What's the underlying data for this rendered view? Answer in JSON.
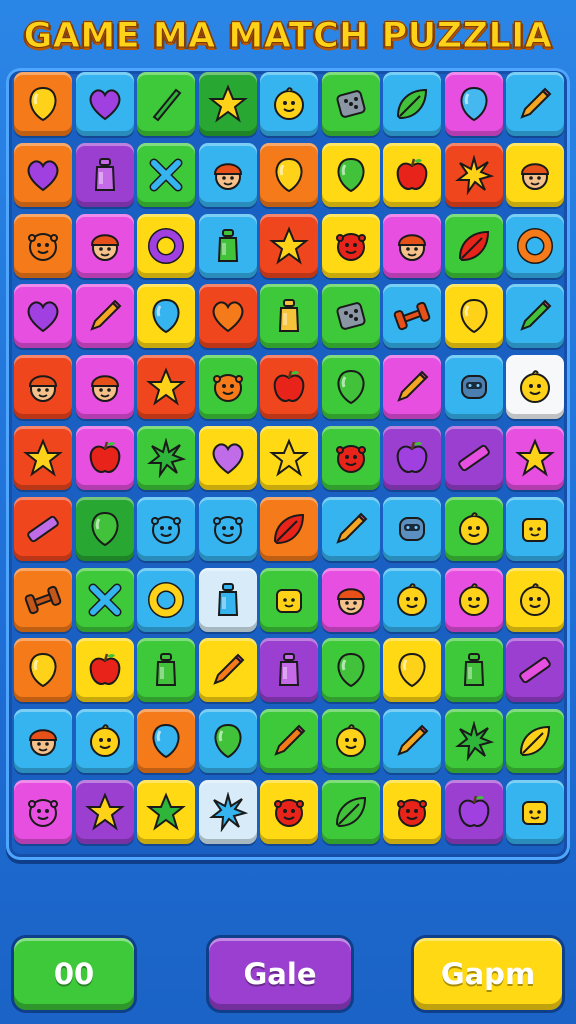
{
  "title": "GAME MA MATCH PUZZLIA",
  "colors": {
    "red": "#f0461e",
    "orange": "#f57a1a",
    "yellow": "#ffd913",
    "green": "#3ec93a",
    "dgreen": "#28a832",
    "blue": "#35b4ef",
    "purple": "#9a3fd0",
    "magenta": "#e64fe0",
    "lblue": "#d7ecf8",
    "white": "#f6f8fa"
  },
  "board": {
    "rows": [
      [
        [
          "orange",
          "balloon",
          "#ffd21a"
        ],
        [
          "blue",
          "heart",
          "#a040e0"
        ],
        [
          "green",
          "stick",
          "#2eb53a"
        ],
        [
          "dgreen",
          "star",
          "#ffd21a"
        ],
        [
          "blue",
          "face",
          "#ffd21a"
        ],
        [
          "green",
          "dice",
          "#8a96a4"
        ],
        [
          "blue",
          "leaf",
          "#42c23a"
        ],
        [
          "magenta",
          "balloon",
          "#45b8f0"
        ],
        [
          "blue",
          "pencil",
          "#f5a623"
        ]
      ],
      [
        [
          "orange",
          "heart",
          "#a040e0"
        ],
        [
          "purple",
          "bottle",
          "#c56be8"
        ],
        [
          "green",
          "cross",
          "#35b4ef"
        ],
        [
          "blue",
          "boy",
          "#f5c08a"
        ],
        [
          "orange",
          "balloon",
          "#ffd21a"
        ],
        [
          "yellow",
          "balloon",
          "#42c23a"
        ],
        [
          "yellow",
          "apple",
          "#e8231a"
        ],
        [
          "red",
          "splat",
          "#ffd21a"
        ],
        [
          "yellow",
          "boy",
          "#f5c08a"
        ]
      ],
      [
        [
          "orange",
          "monster",
          "#f57a1a"
        ],
        [
          "magenta",
          "boy",
          "#f5c08a"
        ],
        [
          "yellow",
          "ring",
          "#a040e0"
        ],
        [
          "blue",
          "bottle",
          "#42c23a"
        ],
        [
          "red",
          "star",
          "#ffd21a"
        ],
        [
          "yellow",
          "monster",
          "#e8231a"
        ],
        [
          "magenta",
          "boy",
          "#f5c08a"
        ],
        [
          "green",
          "leaf",
          "#e8231a"
        ],
        [
          "blue",
          "ring",
          "#f57a1a"
        ]
      ],
      [
        [
          "magenta",
          "heart",
          "#a040e0"
        ],
        [
          "magenta",
          "pencil",
          "#f5a623"
        ],
        [
          "yellow",
          "balloon",
          "#35b4ef"
        ],
        [
          "red",
          "heart",
          "#f57a1a"
        ],
        [
          "green",
          "bottle",
          "#f5c23a"
        ],
        [
          "green",
          "dice",
          "#8a96a4"
        ],
        [
          "blue",
          "dumbbell",
          "#e8501a"
        ],
        [
          "yellow",
          "balloon",
          "#ffd21a"
        ],
        [
          "blue",
          "pencil",
          "#42c23a"
        ]
      ],
      [
        [
          "red",
          "boy",
          "#f5c08a"
        ],
        [
          "magenta",
          "boy",
          "#f5c08a"
        ],
        [
          "red",
          "star",
          "#ffd21a"
        ],
        [
          "green",
          "monster",
          "#f57a1a"
        ],
        [
          "red",
          "apple",
          "#e8231a"
        ],
        [
          "green",
          "balloon",
          "#42c23a"
        ],
        [
          "magenta",
          "pencil",
          "#f5a623"
        ],
        [
          "blue",
          "robot",
          "#4a7fb0"
        ],
        [
          "white",
          "face",
          "#ffd21a"
        ]
      ],
      [
        [
          "red",
          "star",
          "#ffd21a"
        ],
        [
          "magenta",
          "apple",
          "#e8231a"
        ],
        [
          "green",
          "splat",
          "#2eb53a"
        ],
        [
          "yellow",
          "heart",
          "#c06be8"
        ],
        [
          "yellow",
          "star",
          "#ffd21a"
        ],
        [
          "green",
          "monster",
          "#e8231a"
        ],
        [
          "purple",
          "apple",
          "#a040e0"
        ],
        [
          "purple",
          "bar",
          "#e64fe0"
        ],
        [
          "magenta",
          "star",
          "#ffd21a"
        ]
      ],
      [
        [
          "red",
          "bar",
          "#c06be8"
        ],
        [
          "dgreen",
          "balloon",
          "#42c23a"
        ],
        [
          "blue",
          "monster",
          "#35b4ef"
        ],
        [
          "blue",
          "monster",
          "#35b4ef"
        ],
        [
          "orange",
          "leaf",
          "#e8231a"
        ],
        [
          "blue",
          "pencil",
          "#f5a623"
        ],
        [
          "blue",
          "robot",
          "#5a8fc0"
        ],
        [
          "green",
          "face",
          "#ffd21a"
        ],
        [
          "blue",
          "cup",
          "#ffd21a"
        ]
      ],
      [
        [
          "orange",
          "dumbbell",
          "#c4561a"
        ],
        [
          "green",
          "cross",
          "#35b4ef"
        ],
        [
          "blue",
          "ring",
          "#ffd21a"
        ],
        [
          "lblue",
          "bottle",
          "#35b4ef"
        ],
        [
          "green",
          "cup",
          "#ffd21a"
        ],
        [
          "magenta",
          "boy",
          "#f5c08a"
        ],
        [
          "blue",
          "face",
          "#ffd21a"
        ],
        [
          "magenta",
          "face",
          "#ffd21a"
        ],
        [
          "yellow",
          "face",
          "#ffd21a"
        ]
      ],
      [
        [
          "orange",
          "balloon",
          "#ffd21a"
        ],
        [
          "yellow",
          "apple",
          "#e8231a"
        ],
        [
          "green",
          "bottle",
          "#42c23a"
        ],
        [
          "yellow",
          "pencil",
          "#f57a1a"
        ],
        [
          "purple",
          "bottle",
          "#c56be8"
        ],
        [
          "green",
          "balloon",
          "#42c23a"
        ],
        [
          "yellow",
          "balloon",
          "#ffd21a"
        ],
        [
          "green",
          "bottle",
          "#42c23a"
        ],
        [
          "purple",
          "bar",
          "#e64fe0"
        ]
      ],
      [
        [
          "blue",
          "boy",
          "#f5c08a"
        ],
        [
          "blue",
          "face",
          "#ffd21a"
        ],
        [
          "orange",
          "balloon",
          "#35b4ef"
        ],
        [
          "blue",
          "balloon",
          "#42c23a"
        ],
        [
          "green",
          "pencil",
          "#f57a1a"
        ],
        [
          "green",
          "face",
          "#ffd21a"
        ],
        [
          "blue",
          "pencil",
          "#f5a623"
        ],
        [
          "green",
          "splat",
          "#2eb53a"
        ],
        [
          "green",
          "leaf",
          "#ffd21a"
        ]
      ],
      [
        [
          "magenta",
          "monster",
          "#e64fe0"
        ],
        [
          "purple",
          "star",
          "#ffd21a"
        ],
        [
          "yellow",
          "star",
          "#2eb53a"
        ],
        [
          "lblue",
          "splat",
          "#35b4ef"
        ],
        [
          "yellow",
          "monster",
          "#e8231a"
        ],
        [
          "green",
          "leaf",
          "#42c23a"
        ],
        [
          "yellow",
          "monster",
          "#e8231a"
        ],
        [
          "purple",
          "apple",
          "#a040e0"
        ],
        [
          "blue",
          "cup",
          "#ffd21a"
        ]
      ]
    ]
  },
  "buttons": {
    "left_label": "00",
    "middle_label": "Gale",
    "right_label": "Gapm",
    "left_color": "#3ec93a",
    "middle_color": "#9a3fd0",
    "right_color": "#ffd913"
  }
}
